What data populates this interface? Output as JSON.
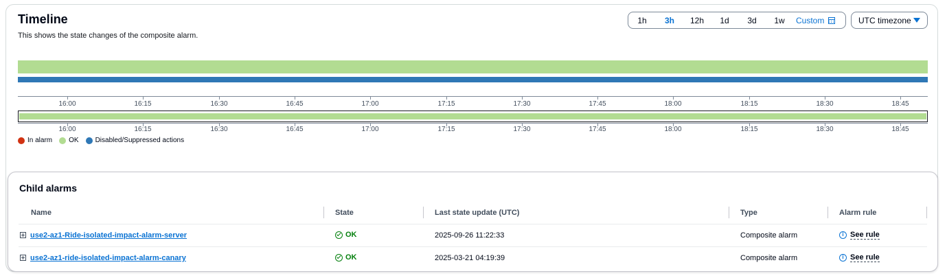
{
  "timeline": {
    "title": "Timeline",
    "description": "This shows the state changes of the composite alarm.",
    "ranges": [
      {
        "label": "1h",
        "active": false
      },
      {
        "label": "3h",
        "active": true
      },
      {
        "label": "12h",
        "active": false
      },
      {
        "label": "1d",
        "active": false
      },
      {
        "label": "3d",
        "active": false
      },
      {
        "label": "1w",
        "active": false
      }
    ],
    "custom_label": "Custom",
    "custom_icon": "calendar-icon",
    "timezone_label": "UTC timezone",
    "timezone_icon": "caret-down-icon",
    "tick_labels": [
      "16:00",
      "16:15",
      "16:30",
      "16:45",
      "17:00",
      "17:15",
      "17:30",
      "17:45",
      "18:00",
      "18:15",
      "18:30",
      "18:45"
    ],
    "legend": [
      {
        "label": "In alarm",
        "color": "#d13212"
      },
      {
        "label": "OK",
        "color": "#b2dc92"
      },
      {
        "label": "Disabled/Suppressed actions",
        "color": "#2f78b6"
      }
    ]
  },
  "child_alarms": {
    "title": "Child alarms",
    "columns": {
      "name": "Name",
      "state": "State",
      "last_update": "Last state update (UTC)",
      "type": "Type",
      "rule": "Alarm rule"
    },
    "rows": [
      {
        "name": "use2-az1-Ride-isolated-impact-alarm-server",
        "state": "OK",
        "last_update": "2025-09-26 11:22:33",
        "type": "Composite alarm",
        "rule": "See rule"
      },
      {
        "name": "use2-az1-ride-isolated-impact-alarm-canary",
        "state": "OK",
        "last_update": "2025-03-21 04:19:39",
        "type": "Composite alarm",
        "rule": "See rule"
      }
    ]
  },
  "colors": {
    "accent": "#0972d3",
    "ok": "#b2dc92",
    "disabled": "#2f78b6",
    "in_alarm": "#d13212",
    "ok_text": "#037f0c"
  }
}
